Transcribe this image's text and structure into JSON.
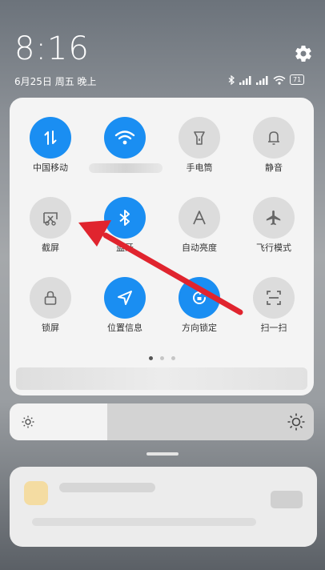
{
  "status_bar": {
    "time": "8:16",
    "date": "6月25日 周五 晚上",
    "battery": "71"
  },
  "quick_settings": {
    "tiles": [
      {
        "label": "中国移动",
        "icon": "data-transfer-icon",
        "state": "on"
      },
      {
        "label": "",
        "icon": "wifi-icon",
        "state": "on"
      },
      {
        "label": "手电筒",
        "icon": "flashlight-icon",
        "state": "off"
      },
      {
        "label": "静音",
        "icon": "bell-icon",
        "state": "off"
      },
      {
        "label": "截屏",
        "icon": "screenshot-icon",
        "state": "off"
      },
      {
        "label": "蓝牙",
        "icon": "bluetooth-icon",
        "state": "on"
      },
      {
        "label": "自动亮度",
        "icon": "auto-brightness-icon",
        "state": "off"
      },
      {
        "label": "飞行模式",
        "icon": "airplane-icon",
        "state": "off"
      },
      {
        "label": "锁屏",
        "icon": "lock-icon",
        "state": "off"
      },
      {
        "label": "位置信息",
        "icon": "location-icon",
        "state": "on"
      },
      {
        "label": "方向锁定",
        "icon": "rotation-lock-icon",
        "state": "on"
      },
      {
        "label": "扫一扫",
        "icon": "scan-icon",
        "state": "off"
      }
    ],
    "pager": {
      "pages": 3,
      "current": 1
    }
  },
  "brightness": {
    "level": 0.32
  },
  "annotation": {
    "color": "#e0242e",
    "points_to": "截屏"
  },
  "colors": {
    "accent": "#1a8ef2",
    "inactive": "#dcdcdc"
  }
}
